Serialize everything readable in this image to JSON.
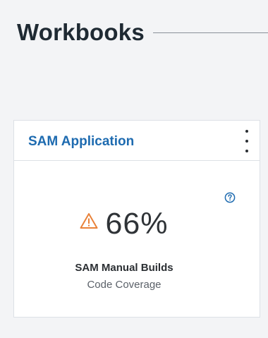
{
  "page": {
    "section_title": "Workbooks"
  },
  "card": {
    "title": "SAM Application",
    "menu_icon": "overflow-menu-vertical-icon",
    "help_icon": "help-icon",
    "status_icon": "warning-icon",
    "value": "66%",
    "build_name": "SAM Manual Builds",
    "metric_label": "Code Coverage"
  },
  "colors": {
    "title_link": "#1e6bb0",
    "help_icon": "#1e6bb0",
    "warning": "#e9823a",
    "page_background": "#f3f4f6",
    "card_background": "#ffffff"
  }
}
